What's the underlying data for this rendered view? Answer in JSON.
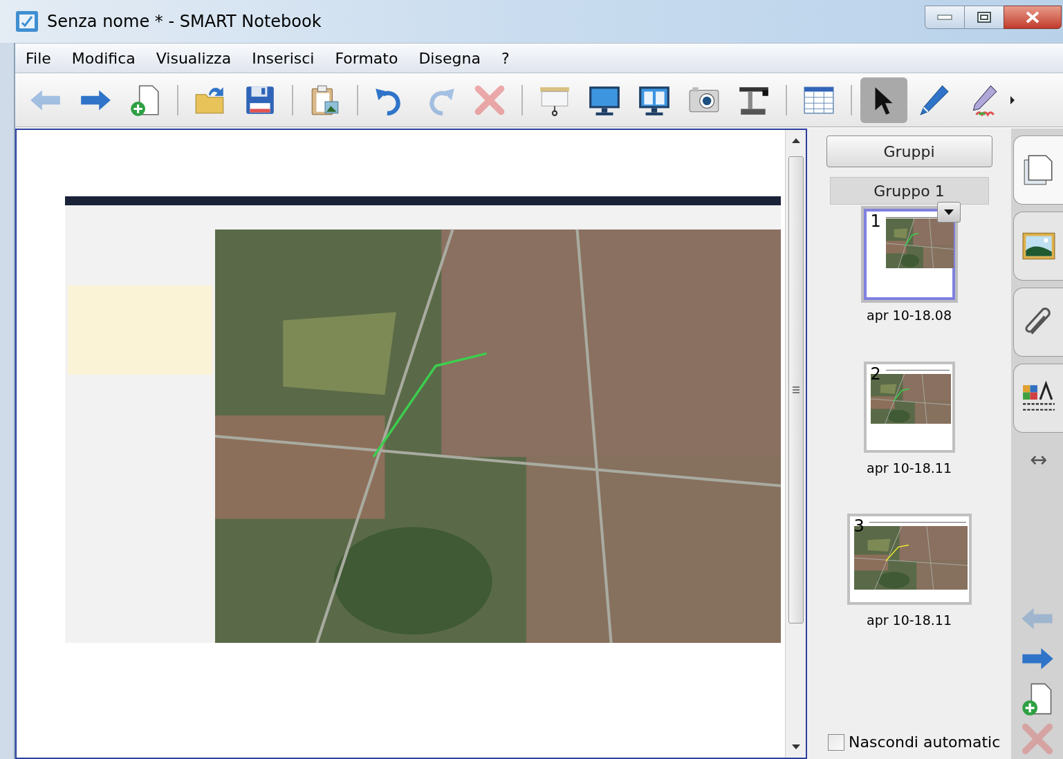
{
  "window": {
    "title": "Senza nome * - SMART Notebook"
  },
  "menu": [
    "File",
    "Modifica",
    "Visualizza",
    "Inserisci",
    "Formato",
    "Disegna",
    "?"
  ],
  "toolbar": [
    [
      {
        "kind": "back",
        "selected": false,
        "disabled": true
      },
      {
        "kind": "forward",
        "selected": false,
        "disabled": false
      },
      {
        "kind": "new-page",
        "selected": false,
        "disabled": false
      }
    ],
    [
      {
        "kind": "open",
        "selected": false,
        "disabled": false
      },
      {
        "kind": "save",
        "selected": false,
        "disabled": false
      }
    ],
    [
      {
        "kind": "paste",
        "selected": false,
        "disabled": false
      }
    ],
    [
      {
        "kind": "undo",
        "selected": false,
        "disabled": false
      },
      {
        "kind": "redo",
        "selected": false,
        "disabled": true
      },
      {
        "kind": "delete",
        "selected": false,
        "disabled": true
      }
    ],
    [
      {
        "kind": "screen-shade",
        "selected": false,
        "disabled": false
      },
      {
        "kind": "full-screen",
        "selected": false,
        "disabled": false
      },
      {
        "kind": "dual-page",
        "selected": false,
        "disabled": false
      },
      {
        "kind": "capture",
        "selected": false,
        "disabled": false
      },
      {
        "kind": "document-camera",
        "selected": false,
        "disabled": false
      }
    ],
    [
      {
        "kind": "table",
        "selected": false,
        "disabled": false
      }
    ],
    [
      {
        "kind": "select",
        "selected": true,
        "disabled": false
      },
      {
        "kind": "pen",
        "selected": false,
        "disabled": false
      },
      {
        "kind": "creative-pen",
        "selected": false,
        "disabled": false
      }
    ]
  ],
  "canvas": {
    "content": {
      "kind": "picture"
    }
  },
  "sorter": {
    "groups_button": "Gruppi",
    "group_label": "Gruppo 1",
    "pages": [
      {
        "number": "1",
        "label": "apr 10-18.08",
        "selected": true
      },
      {
        "number": "2",
        "label": "apr 10-18.11",
        "selected": false
      },
      {
        "number": "3",
        "label": "apr 10-18.11",
        "selected": false
      }
    ],
    "auto_hide": {
      "label": "Nascondi automatic",
      "checked": false
    }
  },
  "side_tabs": [
    {
      "kind": "pages",
      "selected": true
    },
    {
      "kind": "gallery",
      "selected": false
    },
    {
      "kind": "attachments",
      "selected": false
    },
    {
      "kind": "properties",
      "selected": false
    }
  ],
  "side_nav": {
    "resize_glyph": "↔",
    "buttons": [
      {
        "kind": "previous",
        "disabled": true
      },
      {
        "kind": "next",
        "disabled": false
      },
      {
        "kind": "add-page",
        "disabled": false
      },
      {
        "kind": "delete-page",
        "disabled": true
      }
    ]
  }
}
